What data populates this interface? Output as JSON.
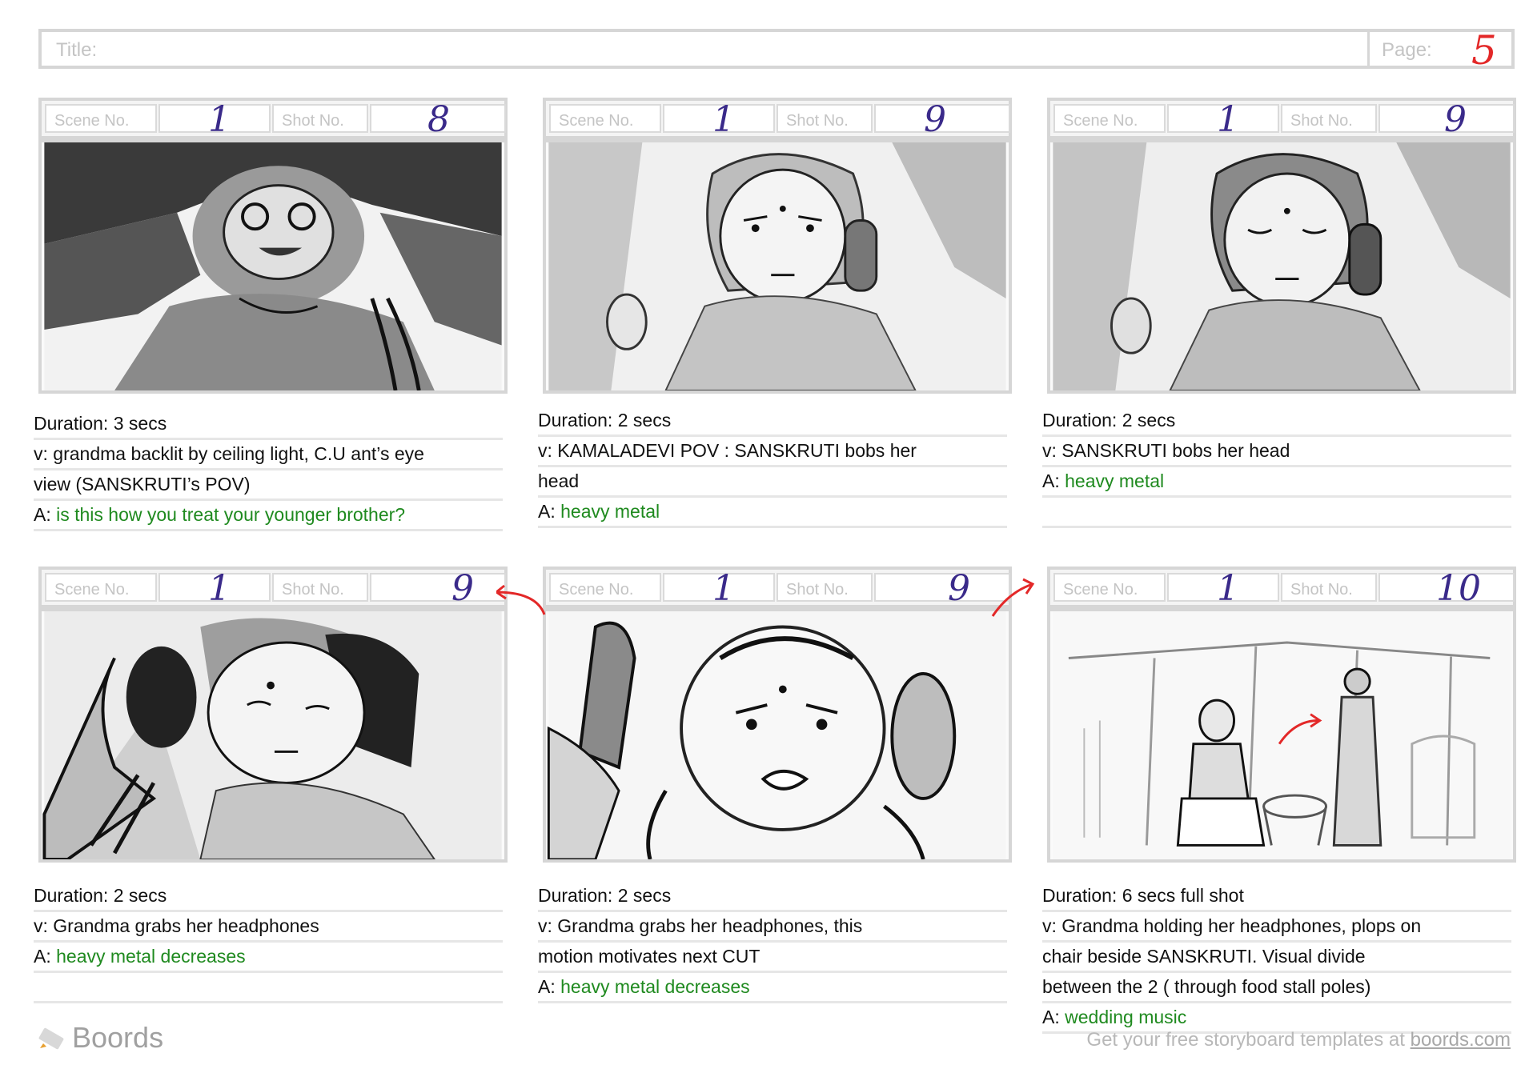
{
  "header": {
    "title_label": "Title:",
    "page_label": "Page:",
    "page_number": "5"
  },
  "labels": {
    "scene": "Scene No.",
    "shot": "Shot No."
  },
  "panels": [
    {
      "scene": "1",
      "shot": "8",
      "lines": [
        {
          "prefix": "",
          "text": "Duration: 3 secs",
          "green": false
        },
        {
          "prefix": "",
          "text": "v: grandma backlit by ceiling light, C.U ant’s eye",
          "green": false
        },
        {
          "prefix": "",
          "text": "view (SANSKRUTI’s POV)",
          "green": false
        },
        {
          "prefix": "A: ",
          "text": "is this how you treat your younger brother?",
          "green": true
        }
      ]
    },
    {
      "scene": "1",
      "shot": "9",
      "lines": [
        {
          "prefix": "",
          "text": "Duration: 2 secs",
          "green": false
        },
        {
          "prefix": "",
          "text": "v: KAMALADEVI POV : SANSKRUTI bobs her",
          "green": false
        },
        {
          "prefix": "",
          "text": "head",
          "green": false
        },
        {
          "prefix": "A: ",
          "text": "heavy metal",
          "green": true
        }
      ]
    },
    {
      "scene": "1",
      "shot": "9",
      "lines": [
        {
          "prefix": "",
          "text": "Duration: 2 secs",
          "green": false
        },
        {
          "prefix": "",
          "text": "v: SANSKRUTI bobs her head",
          "green": false
        },
        {
          "prefix": "A: ",
          "text": "heavy metal",
          "green": true
        },
        {
          "prefix": "",
          "text": "",
          "green": false
        }
      ]
    },
    {
      "scene": "1",
      "shot": "9",
      "lines": [
        {
          "prefix": "",
          "text": "Duration: 2 secs",
          "green": false
        },
        {
          "prefix": "",
          "text": "v: Grandma grabs her headphones",
          "green": false
        },
        {
          "prefix": "A: ",
          "text": "heavy metal decreases",
          "green": true
        },
        {
          "prefix": "",
          "text": "",
          "green": false
        }
      ]
    },
    {
      "scene": "1",
      "shot": "9",
      "lines": [
        {
          "prefix": "",
          "text": "Duration: 2 secs",
          "green": false
        },
        {
          "prefix": "",
          "text": "v: Grandma grabs her headphones, this",
          "green": false
        },
        {
          "prefix": "",
          "text": "motion motivates next CUT",
          "green": false
        },
        {
          "prefix": "A: ",
          "text": "heavy metal decreases",
          "green": true
        }
      ]
    },
    {
      "scene": "1",
      "shot": "10",
      "lines": [
        {
          "prefix": "",
          "text": "Duration: 6 secs  full shot",
          "green": false
        },
        {
          "prefix": "",
          "text": "v: Grandma holding her headphones, plops on",
          "green": false
        },
        {
          "prefix": "",
          "text": "chair beside SANSKRUTI. Visual divide",
          "green": false
        },
        {
          "prefix": "",
          "text": "between the 2 ( through food stall poles)",
          "green": false
        },
        {
          "prefix": "A: ",
          "text": "wedding music",
          "green": true
        }
      ]
    }
  ],
  "footer": {
    "brand": "Boords",
    "note": "Get your free storyboard templates at ",
    "link": "boords.com"
  },
  "colors": {
    "accent_red": "#e32828",
    "handwriting": "#3a2a8a",
    "audio_green": "#1f8a1f"
  }
}
